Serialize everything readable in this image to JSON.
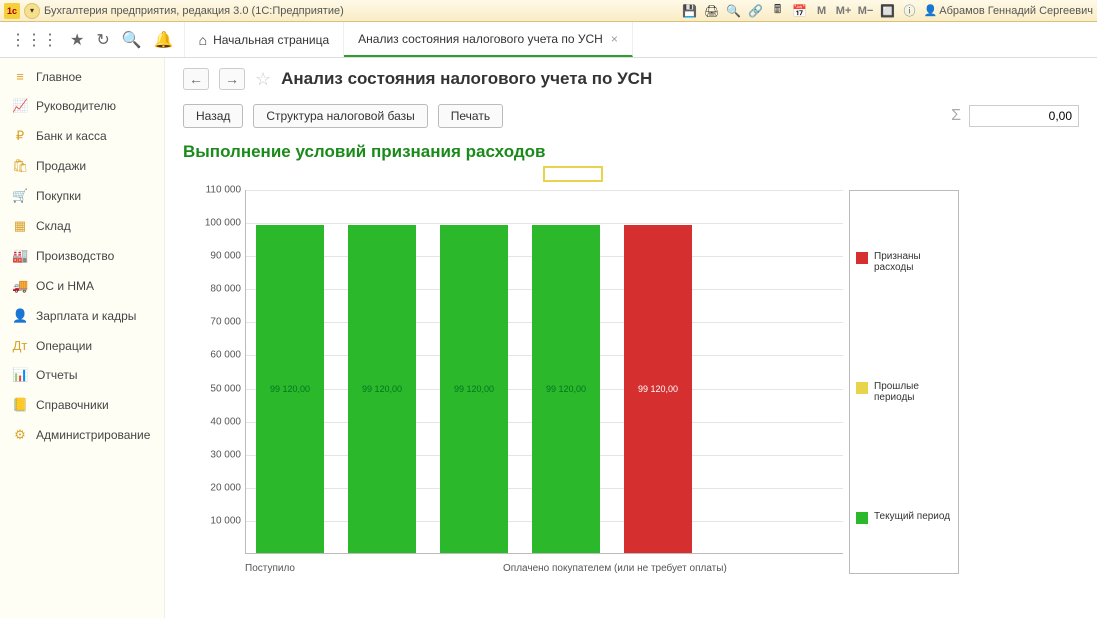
{
  "titlebar": {
    "app_title": "Бухгалтерия предприятия, редакция 3.0  (1С:Предприятие)",
    "user": "Абрамов Геннадий Сергеевич"
  },
  "tabs": {
    "home": "Начальная страница",
    "active": "Анализ состояния налогового учета по УСН"
  },
  "sidebar": {
    "items": [
      {
        "icon": "≡",
        "label": "Главное"
      },
      {
        "icon": "📈",
        "label": "Руководителю"
      },
      {
        "icon": "₽",
        "label": "Банк и касса"
      },
      {
        "icon": "🛍",
        "label": "Продажи"
      },
      {
        "icon": "🛒",
        "label": "Покупки"
      },
      {
        "icon": "▦",
        "label": "Склад"
      },
      {
        "icon": "🏭",
        "label": "Производство"
      },
      {
        "icon": "🚚",
        "label": "ОС и НМА"
      },
      {
        "icon": "👤",
        "label": "Зарплата и кадры"
      },
      {
        "icon": "Дт",
        "label": "Операции"
      },
      {
        "icon": "📊",
        "label": "Отчеты"
      },
      {
        "icon": "📒",
        "label": "Справочники"
      },
      {
        "icon": "⚙",
        "label": "Администрирование"
      }
    ]
  },
  "page": {
    "title": "Анализ состояния налогового учета по УСН",
    "btn_back": "Назад",
    "btn_structure": "Структура налоговой базы",
    "btn_print": "Печать",
    "amount": "0,00"
  },
  "chart_data": {
    "type": "bar",
    "title": "Выполнение условий признания расходов",
    "ylim": [
      0,
      110000
    ],
    "yticks": [
      10000,
      20000,
      30000,
      40000,
      50000,
      60000,
      70000,
      80000,
      90000,
      100000,
      110000
    ],
    "ytick_labels": [
      "10 000",
      "20 000",
      "30 000",
      "40 000",
      "50 000",
      "60 000",
      "70 000",
      "80 000",
      "90 000",
      "100 000",
      "110 000"
    ],
    "bars": [
      {
        "value": 99120.0,
        "label": "99 120,00",
        "color": "green"
      },
      {
        "value": 99120.0,
        "label": "99 120,00",
        "color": "green"
      },
      {
        "value": 99120.0,
        "label": "99 120,00",
        "color": "green"
      },
      {
        "value": 99120.0,
        "label": "99 120,00",
        "color": "green"
      },
      {
        "value": 99120.0,
        "label": "99 120,00",
        "color": "red"
      }
    ],
    "x_labels": {
      "left": "Поступило",
      "right": "Оплачено покупателем (или не требует оплаты)"
    },
    "legend": [
      {
        "color": "#d62f2f",
        "label": "Признаны расходы"
      },
      {
        "color": "#e8d44a",
        "label": "Прошлые периоды"
      },
      {
        "color": "#2bb82b",
        "label": "Текущий период"
      }
    ]
  }
}
